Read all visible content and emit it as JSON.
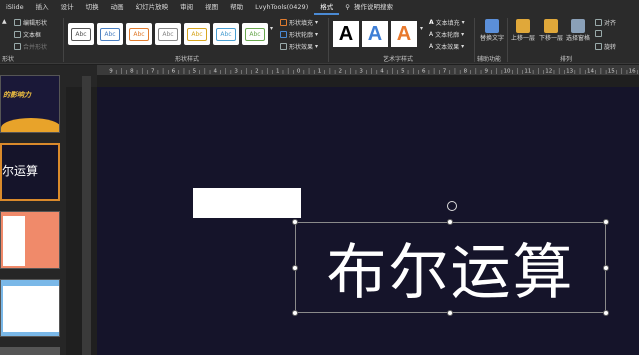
{
  "tabs": [
    "iSlide",
    "插入",
    "设计",
    "切换",
    "动画",
    "幻灯片放映",
    "审阅",
    "视图",
    "帮助",
    "LvyhTools(0429)",
    "格式",
    "操作说明搜索"
  ],
  "active_tab": "格式",
  "ribbon": {
    "insert_shapes": {
      "edit_shape": "编辑形状",
      "text_box": "文本框",
      "merge_shapes": "合并形状",
      "label": "形状"
    },
    "shape_styles": {
      "style_text": "Abc",
      "fill": "形状填充",
      "outline": "形状轮廓",
      "effects": "形状效果",
      "label": "形状样式"
    },
    "wordart": {
      "letter": "A",
      "text_fill": "文本填充",
      "text_outline": "文本轮廓",
      "text_effects": "文本效果",
      "label": "艺术字样式"
    },
    "accessibility": {
      "alt_text": "替换文字",
      "label": "辅助功能"
    },
    "arrange": {
      "bring_forward": "上移一层",
      "send_backward": "下移一层",
      "selection_pane": "选择窗格",
      "align": "对齐",
      "rotate": "旋转",
      "label": "排列"
    }
  },
  "ruler": {
    "labels": [
      "9",
      "8",
      "7",
      "6",
      "5",
      "4",
      "3",
      "2",
      "1",
      "0",
      "1",
      "2",
      "3",
      "4",
      "5",
      "6",
      "7",
      "8",
      "9",
      "10",
      "11",
      "12",
      "13",
      "14",
      "15",
      "16"
    ]
  },
  "thumbnails": [
    {
      "text": "的影响力"
    },
    {
      "text": "尔运算"
    },
    {
      "text": ""
    },
    {
      "text": ""
    }
  ],
  "slide": {
    "title": "布尔运算"
  },
  "colors": {
    "slide_bg": "#15142a",
    "accent": "#4a8ad4"
  }
}
